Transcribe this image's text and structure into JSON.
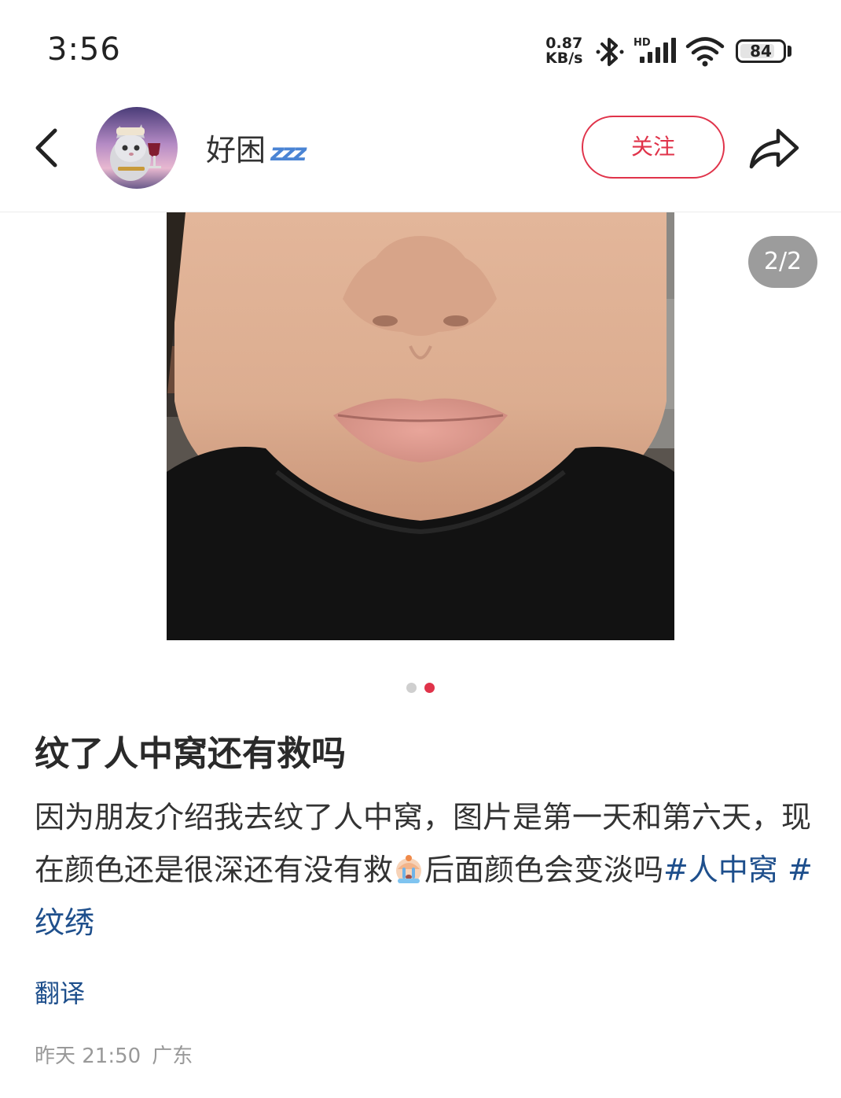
{
  "status_bar": {
    "time": "3:56",
    "net_speed_value": "0.87",
    "net_speed_unit": "KB/s",
    "signal_label": "HD",
    "battery_level": "84",
    "battery_fraction": 0.84
  },
  "header": {
    "username": "好困",
    "username_decoration": "zzz",
    "follow_label": "关注"
  },
  "gallery": {
    "counter": "2/2",
    "current_index": 2,
    "total": 2
  },
  "post": {
    "title": "纹了人中窝还有救吗",
    "body_part1": "因为朋友介绍我去纹了人中窝，图片是第一天和第六天，现在颜色还是很深还有没有救",
    "body_part2": "后面颜色会变淡吗",
    "tags": [
      "#人中窝",
      "#纹绣"
    ],
    "translate_label": "翻译",
    "date": "昨天 21:50",
    "location": "广东"
  },
  "colors": {
    "accent": "#e0334a",
    "link": "#1e4f8c"
  }
}
